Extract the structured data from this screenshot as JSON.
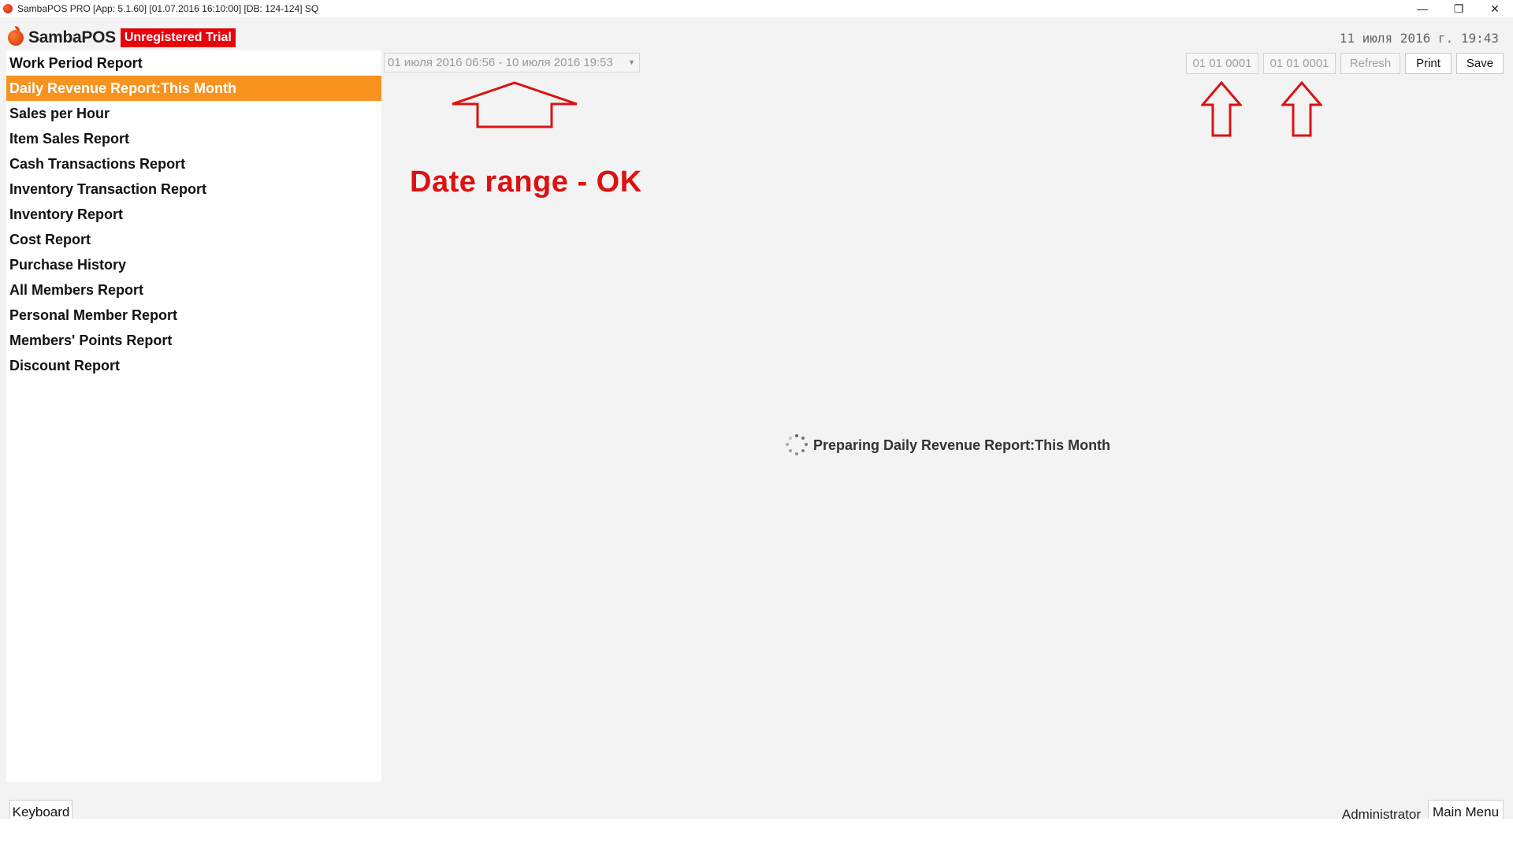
{
  "window": {
    "title": "SambaPOS PRO [App: 5.1.60] [01.07.2016 16:10:00] [DB: 124-124] SQ",
    "controls": [
      "—",
      "❐",
      "✕"
    ]
  },
  "header": {
    "logo_text": "SambaPOS",
    "trial_badge": "Unregistered Trial",
    "clock": "11 июля 2016 г. 19:43"
  },
  "sidebar": {
    "items": [
      {
        "label": "Work Period Report",
        "active": false
      },
      {
        "label": "Daily Revenue Report:This Month",
        "active": true
      },
      {
        "label": "Sales per Hour",
        "active": false
      },
      {
        "label": "Item Sales Report",
        "active": false
      },
      {
        "label": "Cash Transactions Report",
        "active": false
      },
      {
        "label": "Inventory Transaction Report",
        "active": false
      },
      {
        "label": "Inventory Report",
        "active": false
      },
      {
        "label": "Cost Report",
        "active": false
      },
      {
        "label": "Purchase History",
        "active": false
      },
      {
        "label": "All Members Report",
        "active": false
      },
      {
        "label": "Personal Member Report",
        "active": false
      },
      {
        "label": "Members' Points Report",
        "active": false
      },
      {
        "label": "Discount Report",
        "active": false
      }
    ]
  },
  "toolbar": {
    "date_range": "01 июля 2016 06:56 - 10 июля 2016 19:53",
    "start_date": "01 01 0001",
    "end_date": "01 01 0001",
    "refresh_label": "Refresh",
    "print_label": "Print",
    "save_label": "Save"
  },
  "annotation": {
    "text": "Date range - OK",
    "color": "#dd1111"
  },
  "main": {
    "loading_text": "Preparing Daily Revenue Report:This Month"
  },
  "footer": {
    "keyboard_label": "Keyboard",
    "user": "Administrator",
    "main_menu_label": "Main Menu"
  },
  "colors": {
    "accent": "#f7931e",
    "trial_red": "#e8000b"
  }
}
